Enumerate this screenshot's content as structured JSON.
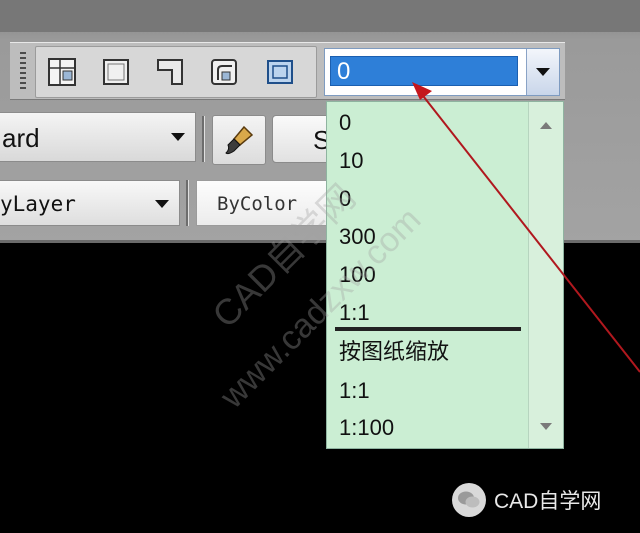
{
  "toolbar": {
    "scale_value": "0",
    "buttons": [
      "layout-icon",
      "rectangle-icon",
      "corner-icon",
      "viewport-clip-icon",
      "viewport-icon"
    ]
  },
  "properties": {
    "text_style": "ard",
    "partial_button": "S",
    "linetype": "yLayer",
    "color": "ByColor"
  },
  "dropdown": {
    "items": [
      "0",
      "10",
      "0",
      "300",
      "100",
      "1:1",
      "按图纸缩放",
      "1:1",
      "1:100"
    ]
  },
  "watermark": [
    "CAD自学网",
    "www.cadzxw.com"
  ],
  "logo": {
    "text": "CAD自学网"
  },
  "colors": {
    "selection": "#2e7fd8",
    "dropdown_bg": "#cbeed3",
    "arrow": "#b0181e",
    "canvas": "#000000"
  }
}
